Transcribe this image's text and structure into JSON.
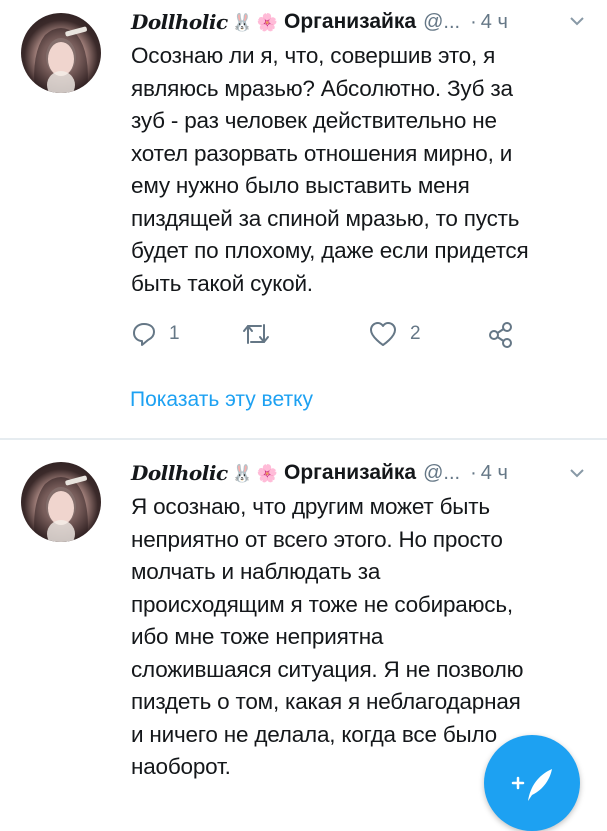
{
  "tweets": [
    {
      "nick": "Dollholic",
      "emoji1": "🐰",
      "emoji2": "🌸",
      "name": "Организайка",
      "handle": "@...",
      "dot": "·",
      "time": "4 ч",
      "lines": [
        "Осознаю ли я, что, совершив это, я",
        "являюсь мразью? Абсолютно. Зуб за",
        "зуб - раз человек действительно не",
        "хотел разорвать отношения мирно, и",
        "ему нужно было выставить меня",
        "пиздящей за спиной мразью, то пусть",
        "будет по плохому, даже если придется",
        "быть такой сукой."
      ],
      "reply_count": "1",
      "retweet_count": "",
      "like_count": "2",
      "show_thread": "Показать эту ветку"
    },
    {
      "nick": "Dollholic",
      "emoji1": "🐰",
      "emoji2": "🌸",
      "name": "Организайка",
      "handle": "@...",
      "dot": "·",
      "time": "4 ч",
      "lines": [
        "Я осознаю, что другим может быть",
        "неприятно от всего этого. Но просто",
        "молчать и наблюдать за",
        "происходящим я тоже не собираюсь,",
        "ибо мне тоже неприятна",
        "сложившаяся ситуация. Я не позволю",
        "пиздеть о том, какая я неблагодарная",
        "и ничего не делала, когда все было",
        "наоборот."
      ]
    }
  ],
  "compose_icon": "feather-plus-icon",
  "colors": {
    "accent": "#1da1f2",
    "secondary_text": "#657786",
    "primary_text": "#14171a",
    "divider": "#e6ecf0"
  }
}
